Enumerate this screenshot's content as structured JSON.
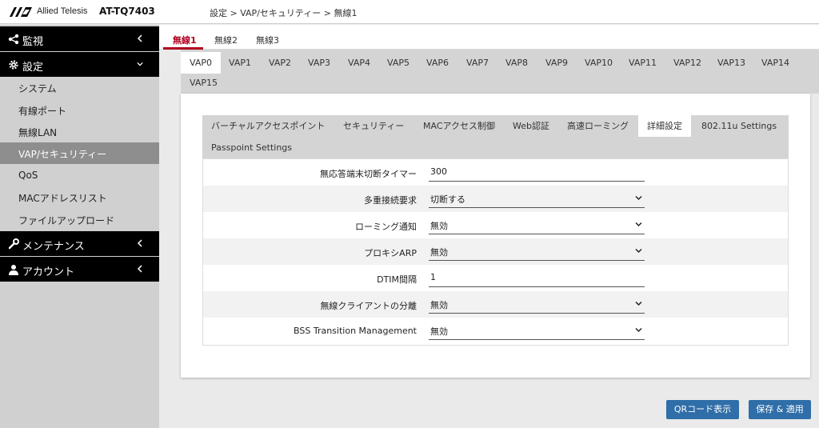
{
  "header": {
    "brand": "Allied Telesis",
    "model": "AT-TQ7403",
    "breadcrumb": "設定 > VAP/セキュリティー > 無線1"
  },
  "sidebar": {
    "sections": [
      {
        "label": "監視",
        "icon": "share-icon"
      },
      {
        "label": "設定",
        "icon": "gear-icon"
      },
      {
        "label": "メンテナンス",
        "icon": "wrench-icon"
      },
      {
        "label": "アカウント",
        "icon": "user-icon"
      }
    ],
    "items": [
      {
        "label": "システム"
      },
      {
        "label": "有線ポート"
      },
      {
        "label": "無線LAN"
      },
      {
        "label": "VAP/セキュリティー",
        "active": true
      },
      {
        "label": "QoS"
      },
      {
        "label": "MACアドレスリスト"
      },
      {
        "label": "ファイルアップロード"
      }
    ]
  },
  "radio_tabs": [
    {
      "label": "無線1",
      "active": true
    },
    {
      "label": "無線2"
    },
    {
      "label": "無線3"
    }
  ],
  "vap_tabs": [
    {
      "label": "VAP0",
      "active": true
    },
    {
      "label": "VAP1"
    },
    {
      "label": "VAP2"
    },
    {
      "label": "VAP3"
    },
    {
      "label": "VAP4"
    },
    {
      "label": "VAP5"
    },
    {
      "label": "VAP6"
    },
    {
      "label": "VAP7"
    },
    {
      "label": "VAP8"
    },
    {
      "label": "VAP9"
    },
    {
      "label": "VAP10"
    },
    {
      "label": "VAP11"
    },
    {
      "label": "VAP12"
    },
    {
      "label": "VAP13"
    },
    {
      "label": "VAP14"
    },
    {
      "label": "VAP15"
    }
  ],
  "sub_tabs": [
    {
      "label": "バーチャルアクセスポイント"
    },
    {
      "label": "セキュリティー"
    },
    {
      "label": "MACアクセス制御"
    },
    {
      "label": "Web認証"
    },
    {
      "label": "高速ローミング"
    },
    {
      "label": "詳細設定",
      "active": true
    },
    {
      "label": "802.11u Settings"
    },
    {
      "label": "Passpoint Settings"
    }
  ],
  "form": [
    {
      "label": "無応答端末切断タイマー",
      "value": "300",
      "type": "text"
    },
    {
      "label": "多重接続要求",
      "value": "切断する",
      "type": "select"
    },
    {
      "label": "ローミング通知",
      "value": "無効",
      "type": "select"
    },
    {
      "label": "プロキシARP",
      "value": "無効",
      "type": "select"
    },
    {
      "label": "DTIM間隔",
      "value": "1",
      "type": "text"
    },
    {
      "label": "無線クライアントの分離",
      "value": "無効",
      "type": "select"
    },
    {
      "label": "BSS Transition Management",
      "value": "無効",
      "type": "select"
    }
  ],
  "buttons": {
    "qr": "QRコード表示",
    "save": "保存 & 適用"
  },
  "colors": {
    "accent": "#b00020",
    "button": "#2f6ea8",
    "sidebar_dark": "#000000",
    "sidebar_active": "#8e8e8e"
  }
}
